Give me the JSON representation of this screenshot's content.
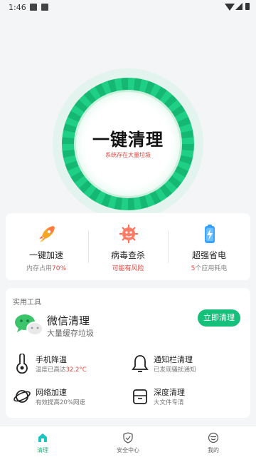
{
  "status_bar": {
    "time": "1:46"
  },
  "hero": {
    "title": "一键清理",
    "subtitle": "系统存在大量垃圾"
  },
  "features": [
    {
      "label": "一键加速",
      "sub_prefix": "内存占用",
      "sub_value": "70%",
      "sub_suffix": "",
      "icon": "rocket-icon"
    },
    {
      "label": "病毒查杀",
      "sub_prefix": "",
      "sub_value": "可能有风险",
      "sub_suffix": "",
      "icon": "virus-icon"
    },
    {
      "label": "超强省电",
      "sub_prefix": "",
      "sub_value": "5",
      "sub_suffix": "个应用耗电",
      "icon": "battery-icon"
    }
  ],
  "tools": {
    "section_title": "实用工具",
    "wechat": {
      "title": "微信清理",
      "subtitle": "大量缓存垃圾",
      "button": "立即清理"
    },
    "items": [
      {
        "name": "手机降温",
        "sub_prefix": "温度已高达",
        "sub_value": "32.2°C",
        "icon": "thermometer-icon"
      },
      {
        "name": "通知栏清理",
        "sub_prefix": "",
        "sub_value": "已发现骚扰通知",
        "icon": "bell-icon"
      },
      {
        "name": "网络加速",
        "sub_prefix": "有效提高20%网速",
        "sub_value": "",
        "icon": "planet-icon"
      },
      {
        "name": "深度清理",
        "sub_prefix": "大文件专清",
        "sub_value": "",
        "icon": "folder-icon"
      }
    ]
  },
  "nav": [
    {
      "label": "清理",
      "icon": "home-icon",
      "active": true
    },
    {
      "label": "安全中心",
      "icon": "shield-icon",
      "active": false
    },
    {
      "label": "我的",
      "icon": "profile-icon",
      "active": false
    }
  ],
  "colors": {
    "accent": "#16c07a",
    "warning": "#e0433a",
    "notice": "#f0a020"
  }
}
